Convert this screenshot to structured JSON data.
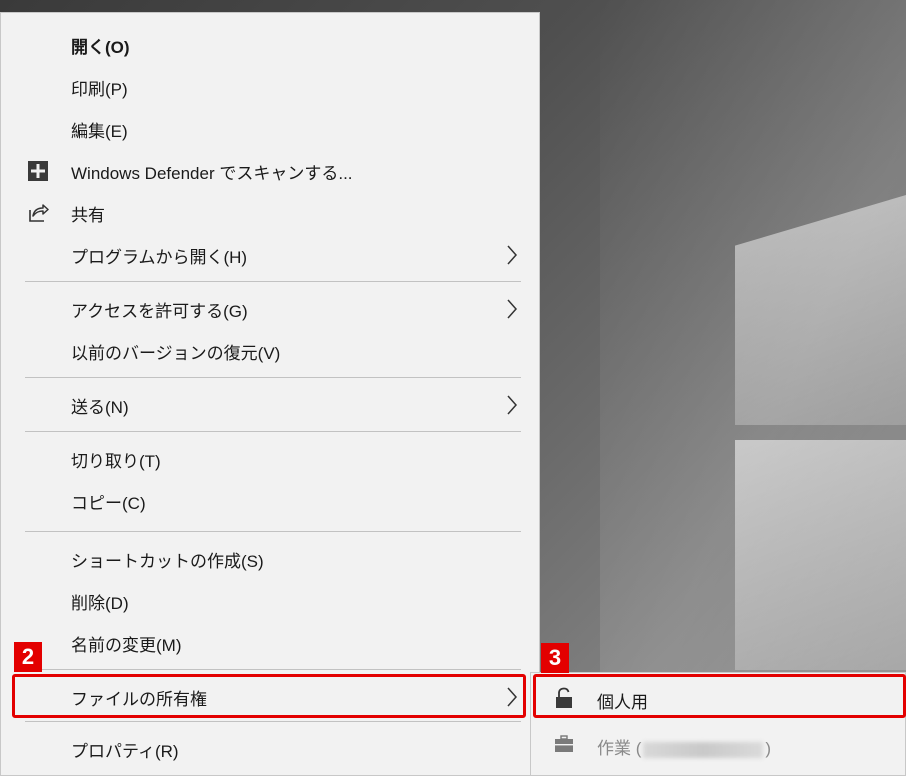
{
  "menu": {
    "items": [
      {
        "label": "開く(O)",
        "bold": true
      },
      {
        "label": "印刷(P)"
      },
      {
        "label": "編集(E)"
      },
      {
        "label": "Windows Defender でスキャンする...",
        "icon": "windows-defender-shield-icon"
      },
      {
        "label": "共有",
        "icon": "share-icon"
      },
      {
        "label": "プログラムから開く(H)",
        "submenu": true
      },
      {
        "label": "アクセスを許可する(G)",
        "submenu": true
      },
      {
        "label": "以前のバージョンの復元(V)"
      },
      {
        "label": "送る(N)",
        "submenu": true
      },
      {
        "label": "切り取り(T)"
      },
      {
        "label": "コピー(C)"
      },
      {
        "label": "ショートカットの作成(S)"
      },
      {
        "label": "削除(D)"
      },
      {
        "label": "名前の変更(M)"
      },
      {
        "label": "ファイルの所有権",
        "submenu": true
      },
      {
        "label": "プロパティ(R)"
      }
    ]
  },
  "submenu": {
    "items": [
      {
        "label": "個人用",
        "icon": "unlock-icon"
      },
      {
        "label_prefix": "作業 (",
        "label_suffix": ")",
        "icon": "briefcase-icon",
        "disabled": true
      }
    ]
  },
  "callouts": {
    "step2": "2",
    "step3": "3"
  },
  "colors": {
    "callout": "#e30000",
    "menu_bg": "#f2f2f2"
  }
}
